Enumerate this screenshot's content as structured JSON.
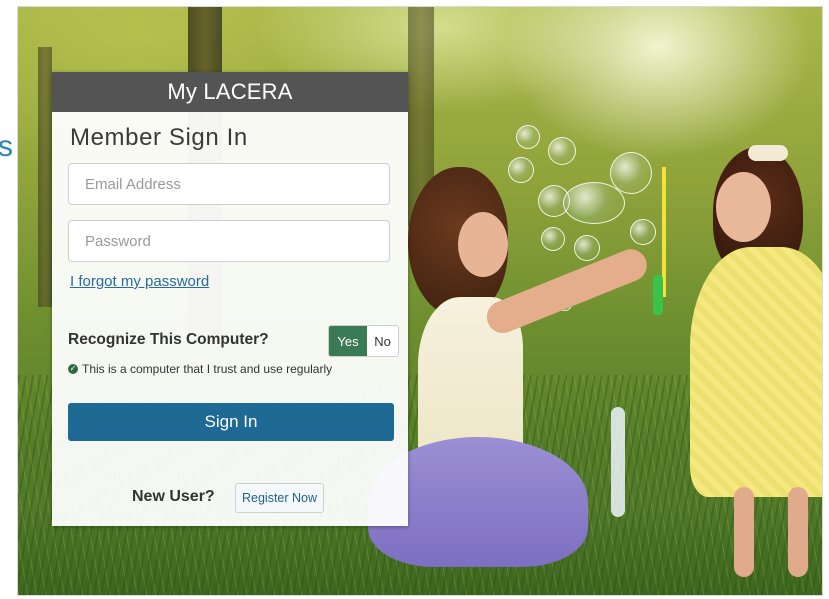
{
  "page": {
    "edge_fragment": "s"
  },
  "login_card": {
    "brand": "My LACERA",
    "title": "Member Sign In",
    "email_placeholder": "Email Address",
    "email_value": "",
    "password_placeholder": "Password",
    "password_value": "",
    "forgot_link": "I forgot my password",
    "recognize_label": "Recognize This Computer?",
    "toggle": {
      "yes": "Yes",
      "no": "No",
      "selected": "Yes"
    },
    "trust_note": "This is a computer that I trust and use regularly",
    "sign_in_button": "Sign In",
    "new_user_label": "New User?",
    "register_button": "Register Now"
  },
  "colors": {
    "header_bg": "#545454",
    "primary_button": "#1f6a94",
    "toggle_active": "#3a7a55",
    "link": "#2a6a9d"
  },
  "icons": {
    "trust_check": "check-circle-icon"
  }
}
